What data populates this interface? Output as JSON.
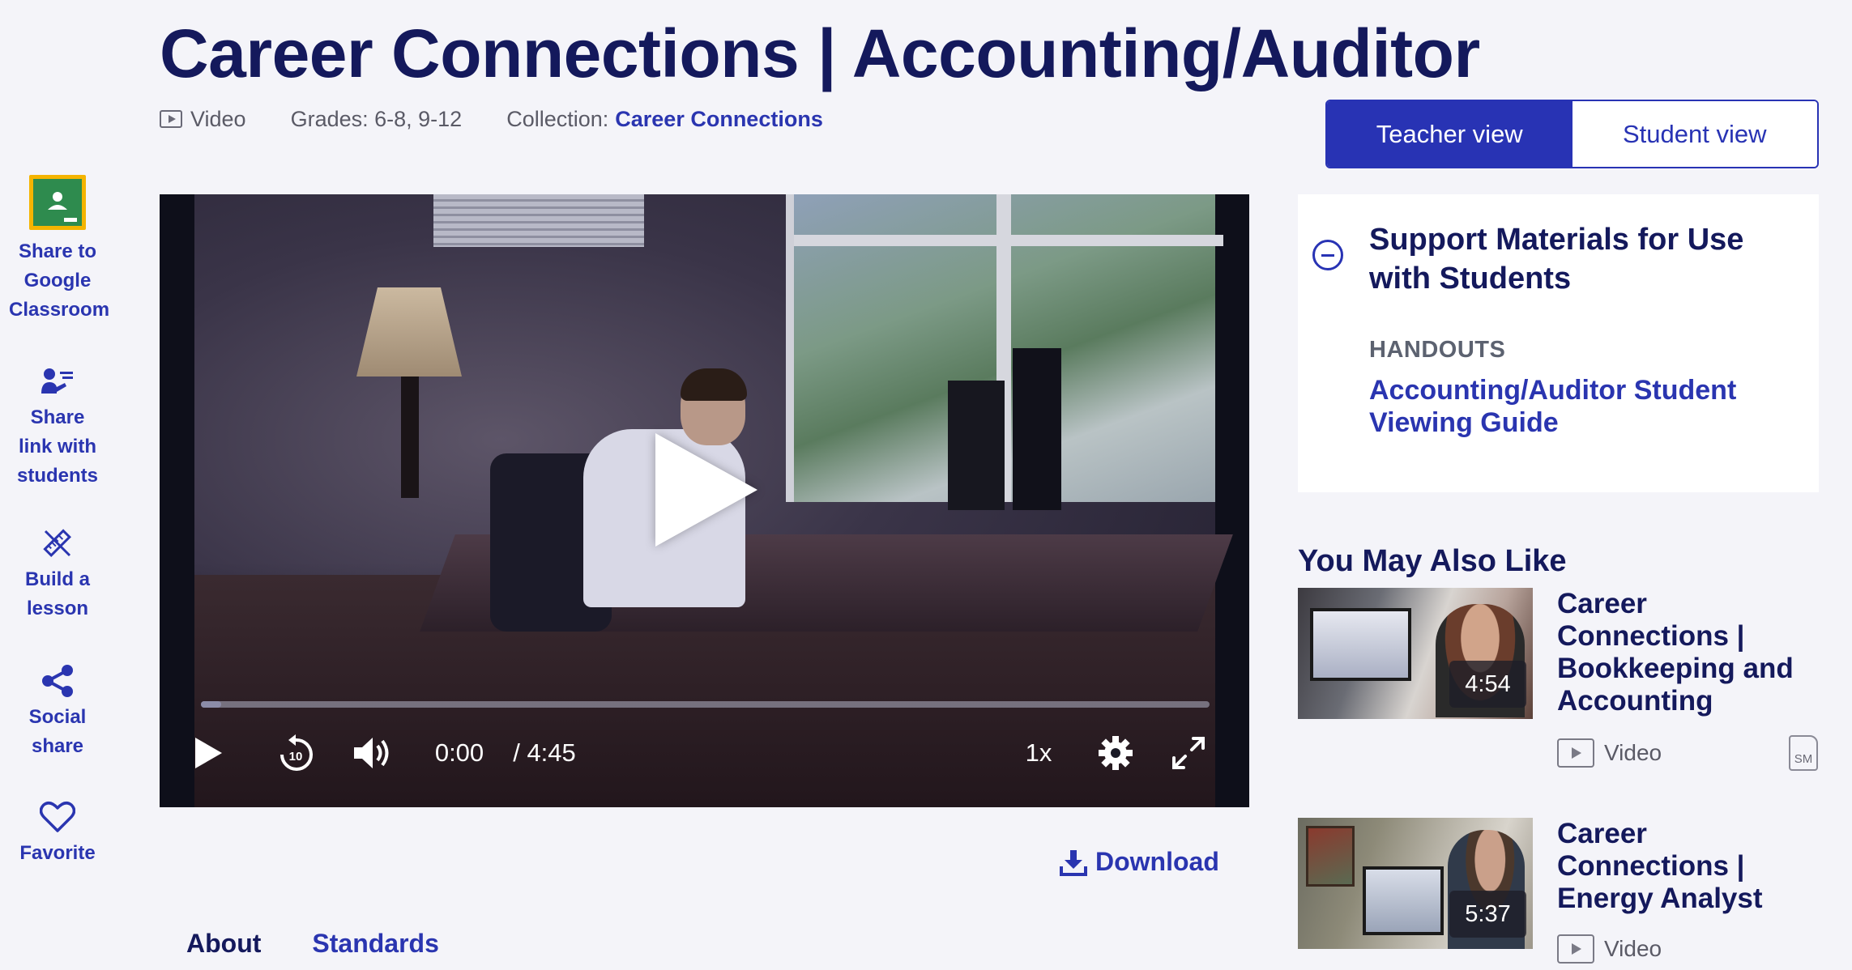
{
  "page": {
    "title": "Career Connections | Accounting/Auditor"
  },
  "meta": {
    "type_label": "Video",
    "grades": "Grades: 6-8, 9-12",
    "collection_label": "Collection:",
    "collection_link": "Career Connections"
  },
  "view_toggle": {
    "teacher": "Teacher view",
    "student": "Student view",
    "active": "teacher"
  },
  "left_rail": {
    "google_classroom": "Share to Google Classroom",
    "share_link": "Share link with students",
    "build_lesson": "Build a lesson",
    "social_share": "Social share",
    "favorite": "Favorite"
  },
  "player": {
    "current_time": "0:00",
    "duration": "/ 4:45",
    "speed": "1x",
    "progress_fraction": 0.02,
    "icons": [
      "play-icon",
      "rewind-10-icon",
      "volume-icon",
      "settings-icon",
      "fullscreen-icon"
    ]
  },
  "download_label": "Download",
  "tabs": {
    "about": "About",
    "standards": "Standards"
  },
  "support": {
    "heading": "Support Materials for Use with Students",
    "section": "HANDOUTS",
    "link": "Accounting/Auditor Student Viewing Guide"
  },
  "recommendations": {
    "heading": "You May Also Like",
    "items": [
      {
        "title": "Career Connections | Bookkeeping and Accounting",
        "duration": "4:54",
        "type": "Video",
        "badge": "SM"
      },
      {
        "title": "Career Connections | Energy Analyst",
        "duration": "5:37",
        "type": "Video"
      }
    ]
  },
  "colors": {
    "brand_navy": "#14195c",
    "accent_blue": "#2833b4",
    "page_bg": "#f4f4f9"
  }
}
